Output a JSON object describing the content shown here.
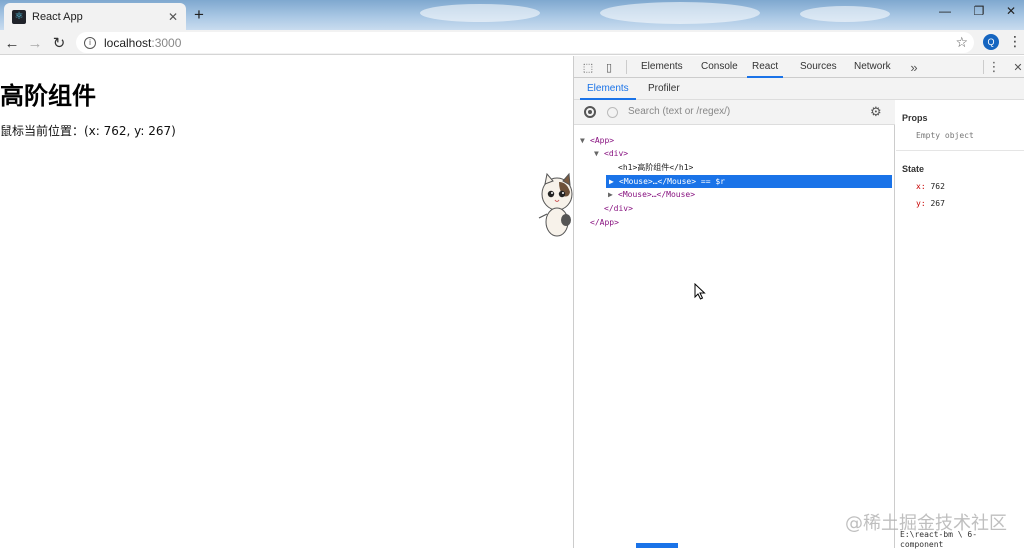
{
  "browser": {
    "tab_title": "React App",
    "url_host": "localhost",
    "url_port": ":3000",
    "profile_initial": "Q"
  },
  "page": {
    "heading": "高阶组件",
    "mouse_position_text": "鼠标当前位置：(x: 762, y: 267)"
  },
  "devtools": {
    "tabs": [
      "Elements",
      "Console",
      "React",
      "Sources",
      "Network"
    ],
    "active_tab": "React",
    "sub_tabs": [
      "Elements",
      "Profiler"
    ],
    "active_sub_tab": "Elements",
    "search_placeholder": "Search (text or /regex/)",
    "tree": {
      "app_open": "<App>",
      "div_open": "<div>",
      "h1_line": "<h1>高阶组件</h1>",
      "mouse1": "<Mouse>…</Mouse>",
      "selected_suffix": " == $r",
      "mouse2": "<Mouse>…</Mouse>",
      "div_close": "</div>",
      "app_close": "</App>"
    },
    "props": {
      "title": "Props",
      "empty": "Empty object"
    },
    "state": {
      "title": "State",
      "x_key": "x:",
      "x_value": "762",
      "y_key": "y:",
      "y_value": "267"
    },
    "path_tip": "E:\\react-bm \\ 6-component"
  },
  "watermark": "@稀土掘金技术社区",
  "colors": {
    "accent": "#1a73e8",
    "tag": "#881280",
    "state_key": "#c80000"
  }
}
